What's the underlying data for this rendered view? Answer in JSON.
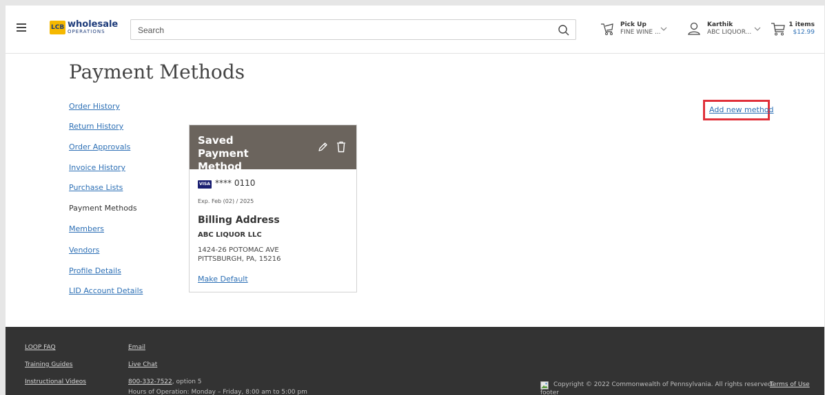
{
  "header": {
    "logo": {
      "badge": "LCB",
      "word1": "wholesale",
      "word2": "OPERATIONS"
    },
    "search": {
      "placeholder": "Search",
      "value": ""
    },
    "pickup": {
      "title": "Pick Up",
      "subtitle": "FINE WINE ..."
    },
    "account": {
      "name": "Karthik",
      "company": "ABC LIQUOR..."
    },
    "cart": {
      "count": "1 items",
      "total": "$12.99"
    }
  },
  "page": {
    "title": "Payment Methods",
    "add_new_label": "Add new method"
  },
  "sidebar": {
    "items": [
      {
        "label": "Order History",
        "active": false
      },
      {
        "label": "Return History",
        "active": false
      },
      {
        "label": "Order Approvals",
        "active": false
      },
      {
        "label": "Invoice History",
        "active": false
      },
      {
        "label": "Purchase Lists",
        "active": false
      },
      {
        "label": "Payment Methods",
        "active": true
      },
      {
        "label": "Members",
        "active": false
      },
      {
        "label": "Vendors",
        "active": false
      },
      {
        "label": "Profile Details",
        "active": false
      },
      {
        "label": "LID Account Details",
        "active": false
      }
    ]
  },
  "card": {
    "title": "Saved Payment Method",
    "card_brand": "VISA",
    "masked_number": "**** 0110",
    "expiry": "Exp. Feb (02) / 2025",
    "billing_title": "Billing Address",
    "company": "ABC LIQUOR LLC",
    "address_line1": "1424-26 POTOMAC AVE",
    "address_line2": "PITTSBURGH, PA, 15216",
    "make_default_label": "Make Default"
  },
  "footer": {
    "col1": [
      "LOOP FAQ",
      "Training Guides",
      "Instructional Videos"
    ],
    "email": "Email",
    "live_chat": "Live Chat",
    "phone": "800-332-7522",
    "phone_suffix": ", option 5",
    "hours": "Hours of Operation: Monday – Friday, 8:00 am to 5:00 pm",
    "copyright": "Copyright © 2022 Commonwealth of Pennsylvania. All rights reserved.",
    "terms": "Terms of Use",
    "img_alt": "footer"
  },
  "colors": {
    "link": "#2c6fb5",
    "card_header": "#6b645d",
    "footer_bg": "#333333",
    "highlight": "#e0303a"
  }
}
